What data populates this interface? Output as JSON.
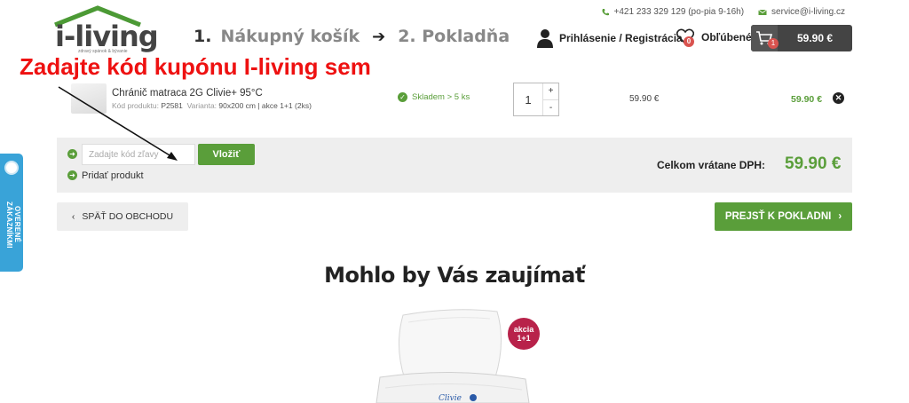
{
  "topbar": {
    "phone": "+421 233 329 129 (po-pia 9-16h)",
    "email": "service@i-living.cz"
  },
  "logo": {
    "text": "i-living",
    "tagline": "zdravý spánok & bývanie"
  },
  "steps": {
    "step1_num": "1.",
    "step1_label": "Nákupný košík",
    "step2": "2. Pokladňa"
  },
  "header": {
    "login_label": "Prihlásenie / Registrácia",
    "favorites_label": "Obľúbené",
    "favorites_count": "0",
    "cart_count": "1",
    "cart_price": "59.90 €"
  },
  "annotation": {
    "text": "Zadajte kód kupónu I-living sem"
  },
  "cart_item": {
    "name": "Chránič matraca 2G Clivie+ 95°C",
    "code_label": "Kód produktu:",
    "code": "P2581",
    "variant_label": "Varianta:",
    "variant": "90x200 cm | akce 1+1 (2ks)",
    "stock": "Skladem > 5 ks",
    "quantity": "1",
    "qty_plus": "+",
    "qty_minus": "-",
    "unit_price": "59.90 €",
    "total_price": "59.90 €"
  },
  "summary": {
    "coupon_placeholder": "Zadajte kód zľavy",
    "coupon_button": "Vložiť",
    "add_product": "Pridať produkt",
    "total_label": "Celkom vrátane DPH:",
    "total_value": "59.90 €"
  },
  "buttons": {
    "back": "SPÄŤ DO OBCHODU",
    "checkout": "PREJSŤ K POKLADNI"
  },
  "side_tab": {
    "label": "OVERENÉ ZÁKAZNÍKMI"
  },
  "recommend": {
    "title": "Mohlo by Vás zaujímať",
    "badge_line1": "akcia",
    "badge_line2": "1+1",
    "product_brand": "Clivie"
  },
  "colors": {
    "accent_green": "#5a9e3a",
    "annotation_red": "#e11111",
    "badge_red": "#d9534f",
    "side_tab_blue": "#39a3d8",
    "akcia_badge": "#b8224a"
  }
}
